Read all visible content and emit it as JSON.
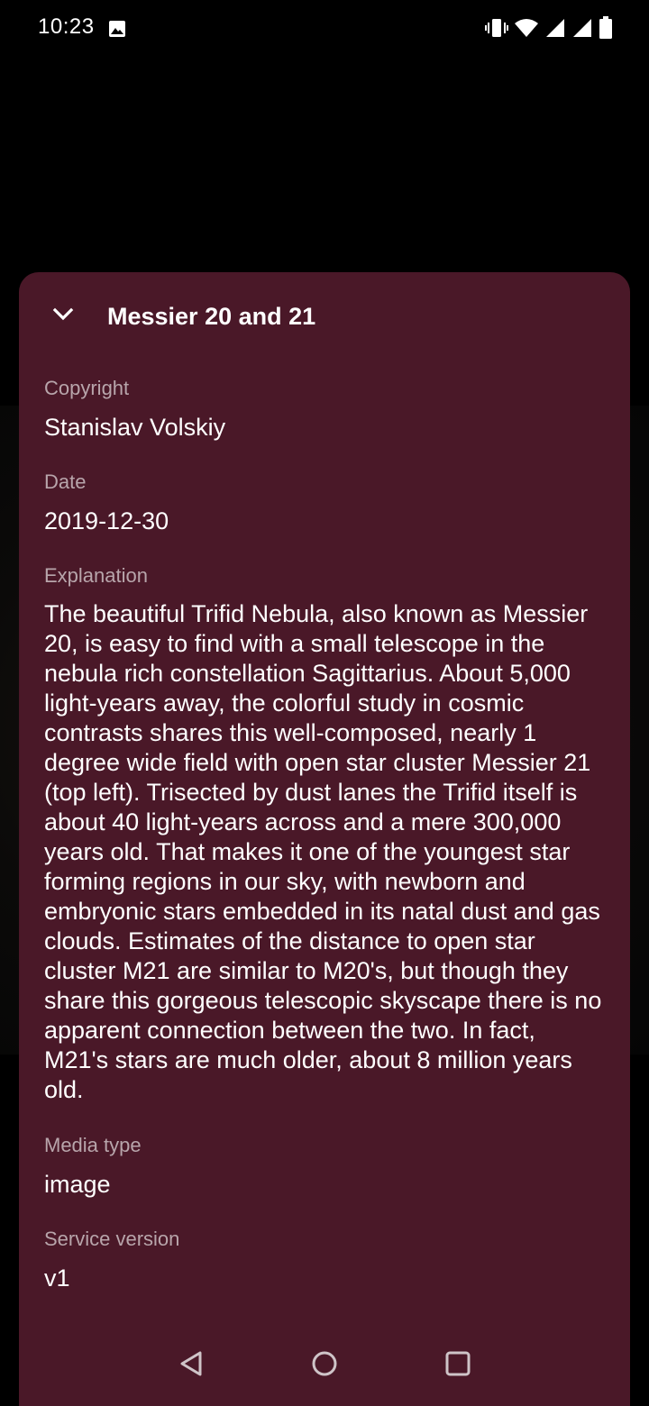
{
  "status_bar": {
    "time": "10:23",
    "icons": [
      "photo-icon",
      "vibrate-icon",
      "wifi-icon",
      "signal-icon",
      "signal-icon",
      "battery-icon"
    ]
  },
  "sheet": {
    "title": "Messier 20 and 21",
    "collapse_icon": "chevron-down-icon",
    "background_color": "#4a1828",
    "fields": {
      "copyright": {
        "label": "Copyright",
        "value": "Stanislav Volskiy"
      },
      "date": {
        "label": "Date",
        "value": "2019-12-30"
      },
      "explanation": {
        "label": "Explanation",
        "value": "The beautiful Trifid Nebula, also known as Messier 20, is easy to find with a small telescope in the nebula rich constellation Sagittarius. About 5,000 light-years away, the colorful study in cosmic contrasts shares this well-composed, nearly 1 degree wide field with open star cluster Messier 21 (top left). Trisected by dust lanes the Trifid itself is about 40 light-years across and a mere 300,000 years old. That makes it one of the youngest star forming regions in our sky, with newborn and embryonic stars embedded in its natal dust and gas clouds. Estimates of the distance to open star cluster M21 are similar to M20's, but though they share this gorgeous telescopic skyscape there is no apparent connection between the two. In fact, M21's stars are much older, about 8 million years old."
      },
      "media_type": {
        "label": "Media type",
        "value": "image"
      },
      "service_version": {
        "label": "Service version",
        "value": "v1"
      }
    }
  },
  "nav_bar": {
    "icons": [
      "back-icon",
      "home-icon",
      "recents-icon"
    ]
  }
}
